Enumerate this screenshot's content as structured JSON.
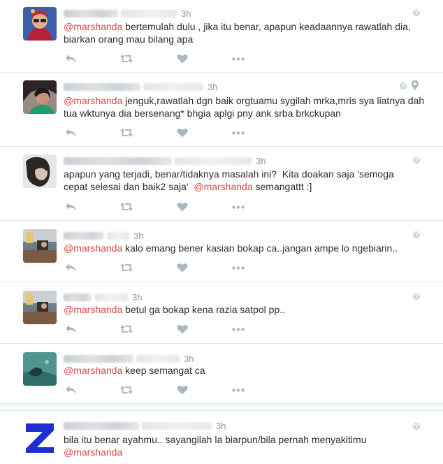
{
  "colors": {
    "mention": "#d84a4a",
    "text": "#292f33",
    "muted": "#8899a6",
    "icon": "#aab8c2",
    "divider": "#e1e8ed"
  },
  "tweets": [
    {
      "time": "3h",
      "mention_first": "@marshanda",
      "body": " bertemulah dulu , jika itu benar, apapun keadaannya rawatlah dia, biarkan orang mau bilang apa",
      "mention_last": "",
      "has_location": false,
      "avatar": "woman-red-hijab"
    },
    {
      "time": "3h",
      "mention_first": "@marshanda",
      "body": " jenguk,rawatlah dgn baik orgtuamu sygilah mrka,mris sya liatnya dah tua wktunya dia bersenang* bhgia aplgi pny ank srba brkckupan",
      "mention_last": "",
      "has_location": true,
      "avatar": "woman-green-top"
    },
    {
      "time": "3h",
      "mention_first": "",
      "body": "apapun yang terjadi, benar/tidaknya masalah ini?  Kita doakan saja 'semoga cepat selesai dan baik2 saja'  ",
      "mention_inline": "@marshanda",
      "body_after": " semangattt :]",
      "mention_last": "",
      "has_location": false,
      "avatar": "woman-dark-hair"
    },
    {
      "time": "3h",
      "mention_first": "@marshanda",
      "body": " kalo emang bener kasian bokap ca..jangan ampe lo ngebiarin..",
      "mention_last": "",
      "has_location": false,
      "avatar": "room-photo"
    },
    {
      "time": "3h",
      "mention_first": "@marshanda",
      "body": " betul ga bokap kena razia satpol pp..",
      "mention_last": "",
      "has_location": false,
      "avatar": "room-photo"
    },
    {
      "time": "3h",
      "mention_first": "@marshanda",
      "body": " keep semangat ca",
      "mention_last": "",
      "has_location": false,
      "avatar": "underwater-photo"
    },
    {
      "time": "3h",
      "mention_first": "",
      "body": "bila itu benar ayahmu.. sayangilah la biarpun/bila pernah menyakitimu",
      "mention_last": "@marshanda",
      "has_location": false,
      "avatar": "blue-z-logo"
    }
  ],
  "icons": {
    "reply": "reply-icon",
    "retweet": "retweet-icon",
    "like": "heart-icon",
    "more": "more-icon",
    "globe": "globe-icon",
    "location": "location-pin-icon"
  }
}
